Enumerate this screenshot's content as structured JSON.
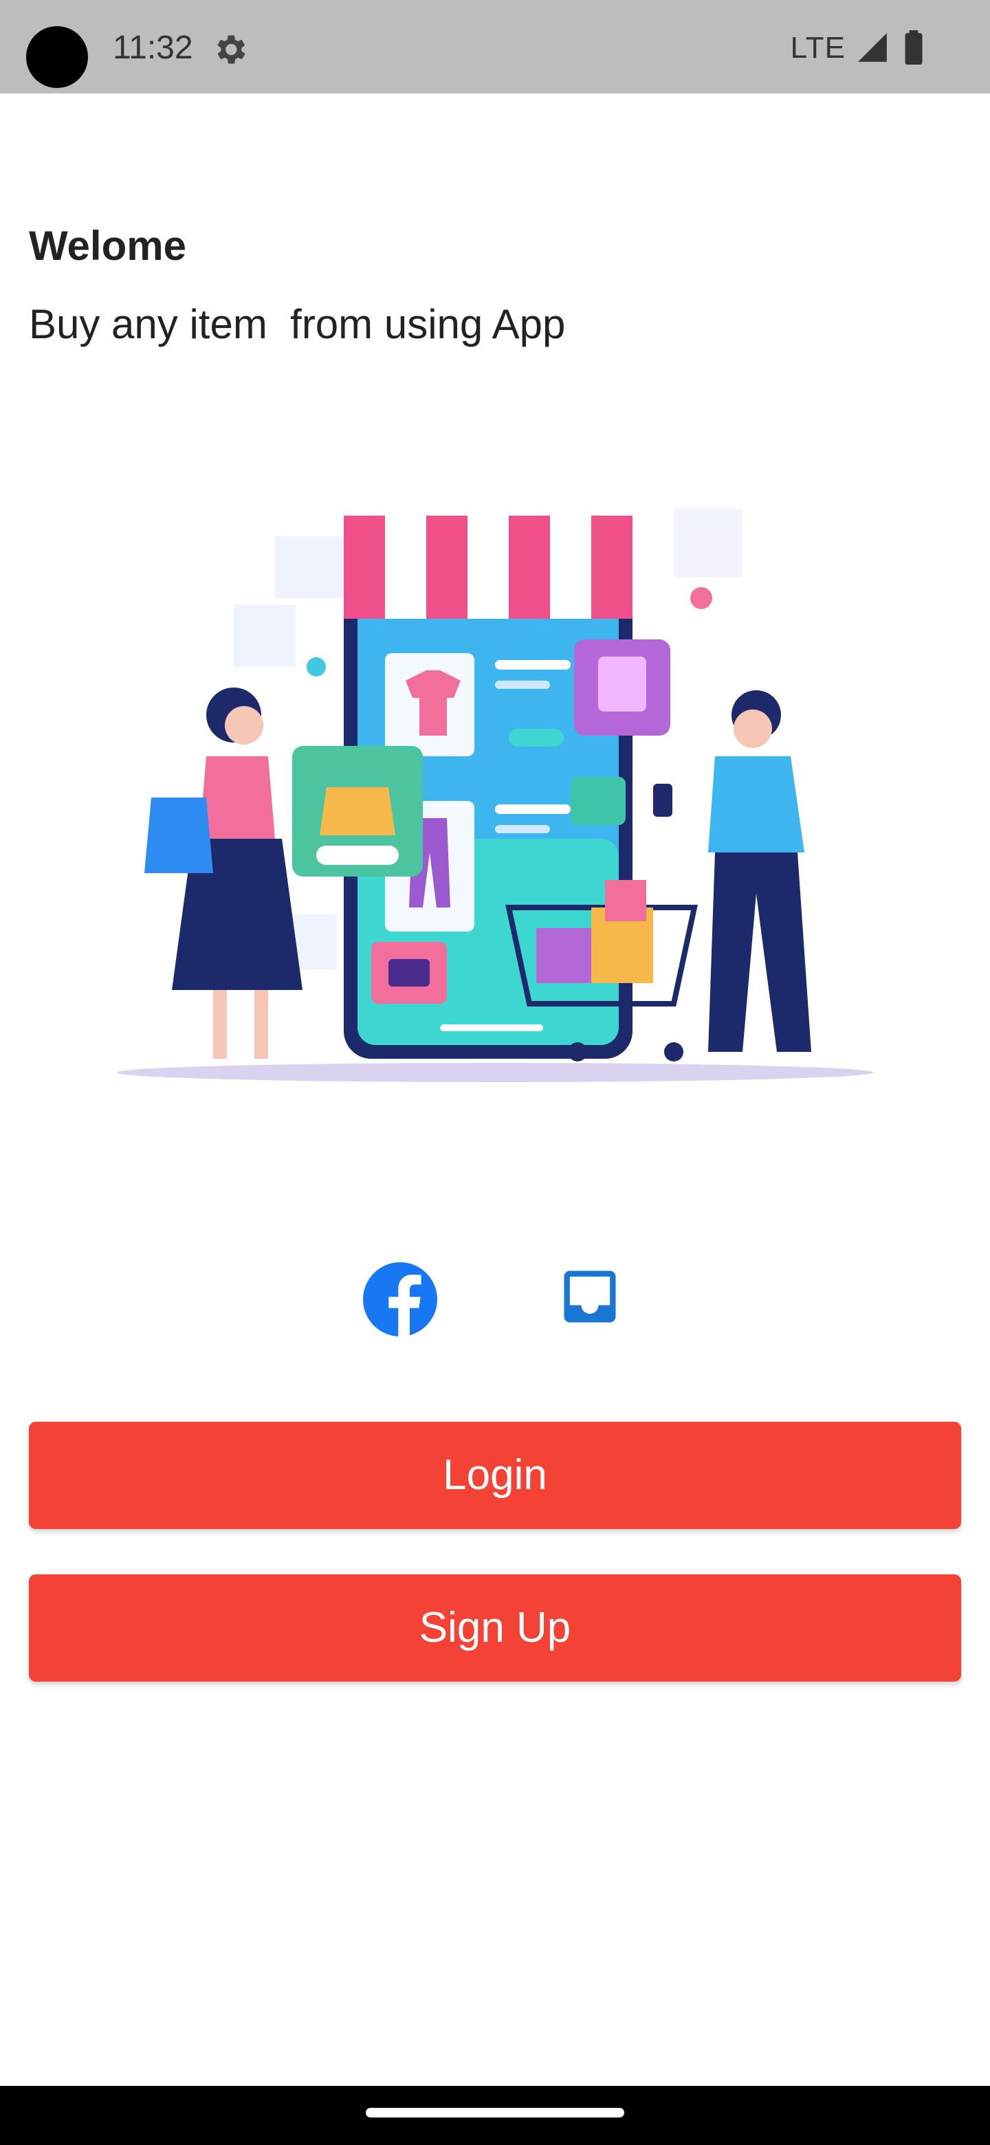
{
  "status_bar": {
    "time": "11:32",
    "network": "LTE",
    "icons": [
      "camera-cutout",
      "gear-icon",
      "signal-icon",
      "battery-icon"
    ]
  },
  "welcome": {
    "title": "Welome",
    "subtitle": "Buy any item  from using App"
  },
  "illustration": {
    "description_icon": "shopping-illustration"
  },
  "social": {
    "icons": [
      "facebook-icon",
      "inbox-icon"
    ],
    "facebook_color": "#1877f2",
    "inbox_color": "#1976d2"
  },
  "actions": {
    "login_label": "Login",
    "signup_label": "Sign Up",
    "button_color": "#f44336"
  }
}
